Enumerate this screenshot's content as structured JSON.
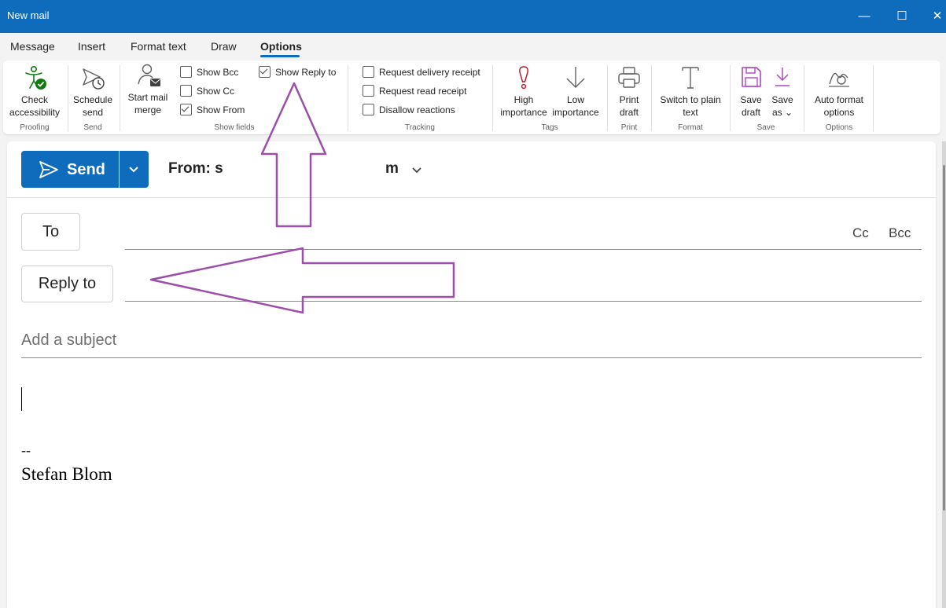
{
  "window": {
    "title": "New mail",
    "minimize": "—",
    "maximize": "☐",
    "close": "✕"
  },
  "tabs": [
    {
      "label": "Message"
    },
    {
      "label": "Insert"
    },
    {
      "label": "Format text"
    },
    {
      "label": "Draw"
    },
    {
      "label": "Options",
      "active": true
    }
  ],
  "ribbon": {
    "proofing": {
      "check_line1": "Check",
      "check_line2": "accessibility",
      "group": "Proofing"
    },
    "send": {
      "schedule_line1": "Schedule",
      "schedule_line2": "send",
      "group": "Send"
    },
    "show_fields": {
      "mail_merge_line1": "Start mail",
      "mail_merge_line2": "merge",
      "show_bcc": "Show Bcc",
      "show_cc": "Show Cc",
      "show_from": "Show From",
      "show_reply_to": "Show Reply to",
      "group": "Show fields"
    },
    "tracking": {
      "delivery": "Request delivery receipt",
      "read": "Request read receipt",
      "reactions": "Disallow reactions",
      "group": "Tracking"
    },
    "tags": {
      "high_line1": "High",
      "high_line2": "importance",
      "low_line1": "Low",
      "low_line2": "importance",
      "group": "Tags"
    },
    "print": {
      "line1": "Print",
      "line2": "draft",
      "group": "Print"
    },
    "format": {
      "line1": "Switch to plain",
      "line2": "text",
      "group": "Format"
    },
    "save": {
      "save_line1": "Save",
      "save_line2": "draft",
      "saveas_line1": "Save",
      "saveas_line2": "as ⌄",
      "group": "Save"
    },
    "options": {
      "line1": "Auto format",
      "line2": "options",
      "group": "Options"
    }
  },
  "compose": {
    "send_label": "Send",
    "from_prefix": "From: s",
    "from_suffix": "m",
    "to_label": "To",
    "cc_label": "Cc",
    "bcc_label": "Bcc",
    "reply_to_label": "Reply to",
    "subject_placeholder": "Add a subject",
    "signature_dash": "--",
    "signature_name": "Stefan Blom"
  },
  "colors": {
    "accent": "#0f6cbd",
    "annotation": "#9b4fa8",
    "accessibility_green": "#107c10",
    "high_importance": "#c50f1f",
    "save_purple": "#b146c2"
  }
}
